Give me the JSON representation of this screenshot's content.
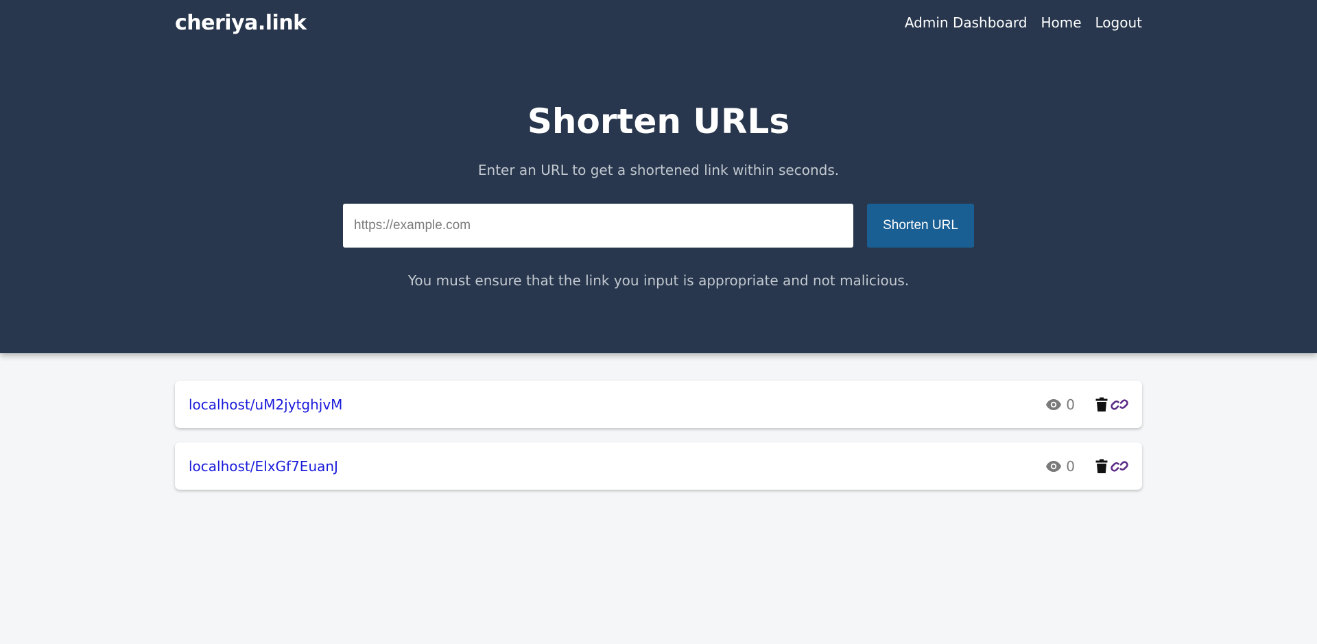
{
  "nav": {
    "brand": "cheriya.link",
    "links": [
      {
        "label": "Admin Dashboard"
      },
      {
        "label": "Home"
      },
      {
        "label": "Logout"
      }
    ]
  },
  "hero": {
    "title": "Shorten URLs",
    "subtitle": "Enter an URL to get a shortened link within seconds.",
    "input_placeholder": "https://example.com",
    "input_value": "",
    "button_label": "Shorten URL",
    "note": "You must ensure that the link you input is appropriate and not malicious."
  },
  "links": [
    {
      "url": "localhost/uM2jytghjvM",
      "views": "0"
    },
    {
      "url": "localhost/ElxGf7EuanJ",
      "views": "0"
    }
  ],
  "icons": {
    "views": "eye-icon",
    "delete": "trash-icon",
    "open": "link-icon"
  },
  "colors": {
    "hero_bg": "#28374d",
    "page_bg": "#f5f6f8",
    "button_bg": "#1a5f94",
    "link_text": "#1a1adb",
    "chain_icon": "#5b2a86"
  }
}
